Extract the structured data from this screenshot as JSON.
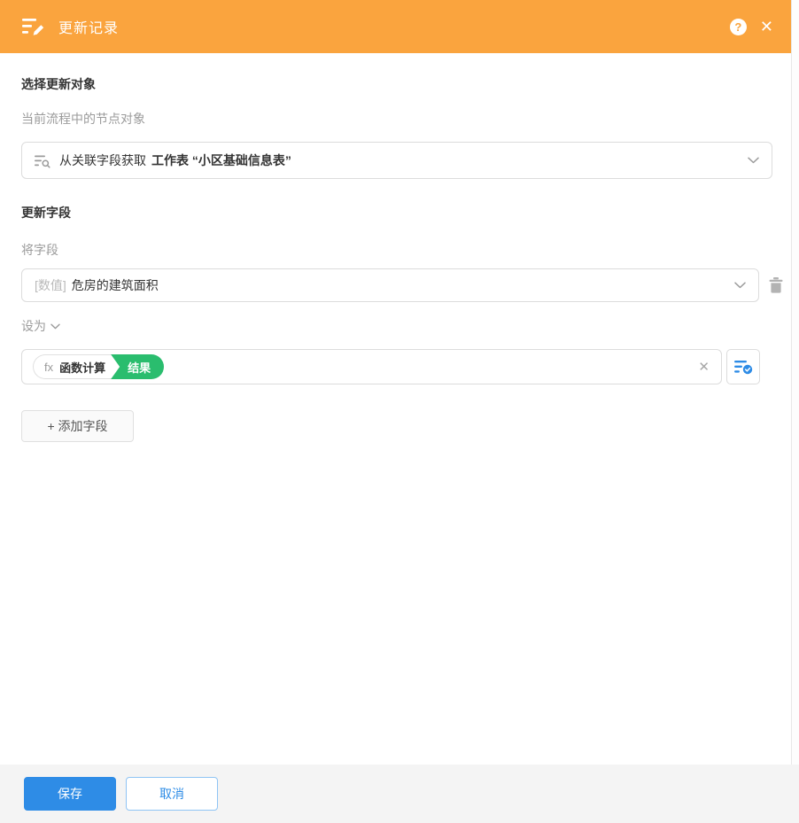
{
  "window": {
    "title": "更新记录"
  },
  "header": {
    "help_icon": "?",
    "close_icon": "✕"
  },
  "select_section": {
    "heading": "选择更新对象",
    "sublabel": "当前流程中的节点对象",
    "node_select": {
      "prefix": "从关联字段获取",
      "value": "工作表 “小区基础信息表”"
    }
  },
  "fields_section": {
    "heading": "更新字段",
    "field_label": "将字段",
    "field_select": {
      "type": "[数值]",
      "value": "危房的建筑面积"
    },
    "set_label": "设为",
    "formula_chip": {
      "fx": "fx",
      "name": "函数计算",
      "badge": "结果"
    },
    "clear_icon": "✕",
    "add_field_button": "+ 添加字段"
  },
  "footer": {
    "save_button": "保存",
    "cancel_button": "取消"
  },
  "colors": {
    "header_bg": "#faa43e",
    "primary_blue": "#2e8ce6",
    "badge_green": "#2abd6e",
    "footer_bg": "#f4f4f4"
  }
}
